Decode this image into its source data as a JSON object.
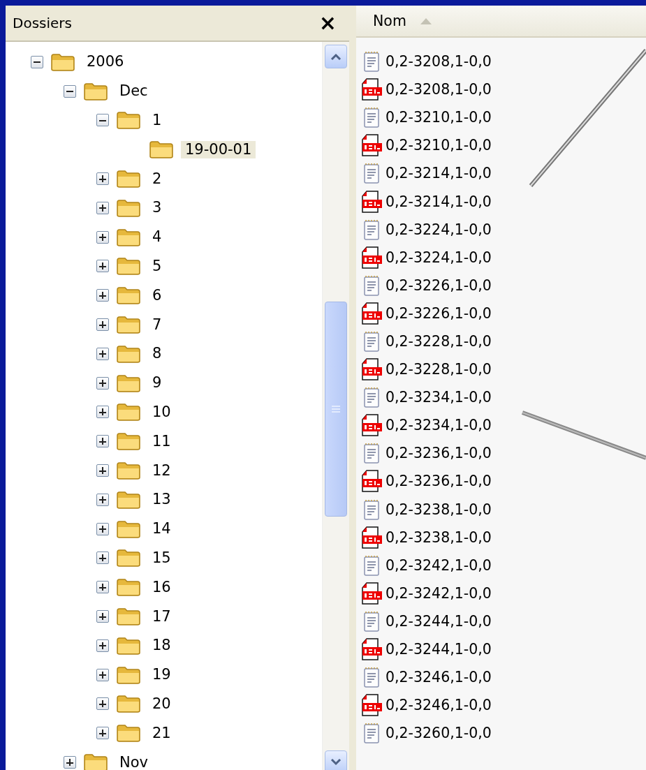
{
  "folders_pane": {
    "title": "Dossiers",
    "close": "×",
    "tree": [
      {
        "label": "2006",
        "expanded": true,
        "selected": false,
        "children": [
          {
            "label": "Dec",
            "expanded": true,
            "selected": false,
            "children": [
              {
                "label": "1",
                "expanded": true,
                "selected": false,
                "children": [
                  {
                    "label": "19-00-01",
                    "selected": true
                  }
                ]
              },
              {
                "label": "2",
                "expanded": false,
                "selected": false
              },
              {
                "label": "3",
                "expanded": false,
                "selected": false
              },
              {
                "label": "4",
                "expanded": false,
                "selected": false
              },
              {
                "label": "5",
                "expanded": false,
                "selected": false
              },
              {
                "label": "6",
                "expanded": false,
                "selected": false
              },
              {
                "label": "7",
                "expanded": false,
                "selected": false
              },
              {
                "label": "8",
                "expanded": false,
                "selected": false
              },
              {
                "label": "9",
                "expanded": false,
                "selected": false
              },
              {
                "label": "10",
                "expanded": false,
                "selected": false
              },
              {
                "label": "11",
                "expanded": false,
                "selected": false
              },
              {
                "label": "12",
                "expanded": false,
                "selected": false
              },
              {
                "label": "13",
                "expanded": false,
                "selected": false
              },
              {
                "label": "14",
                "expanded": false,
                "selected": false
              },
              {
                "label": "15",
                "expanded": false,
                "selected": false
              },
              {
                "label": "16",
                "expanded": false,
                "selected": false
              },
              {
                "label": "17",
                "expanded": false,
                "selected": false
              },
              {
                "label": "18",
                "expanded": false,
                "selected": false
              },
              {
                "label": "19",
                "expanded": false,
                "selected": false
              },
              {
                "label": "20",
                "expanded": false,
                "selected": false
              },
              {
                "label": "21",
                "expanded": false,
                "selected": false
              }
            ]
          },
          {
            "label": "Nov",
            "expanded": false,
            "selected": false
          }
        ]
      }
    ]
  },
  "file_list": {
    "columns": [
      "Nom"
    ],
    "files": [
      {
        "name": "0,2-3208,1-0,0",
        "kind": "text"
      },
      {
        "name": "0,2-3208,1-0,0",
        "kind": "xml"
      },
      {
        "name": "0,2-3210,1-0,0",
        "kind": "text"
      },
      {
        "name": "0,2-3210,1-0,0",
        "kind": "xml"
      },
      {
        "name": "0,2-3214,1-0,0",
        "kind": "text"
      },
      {
        "name": "0,2-3214,1-0,0",
        "kind": "xml"
      },
      {
        "name": "0,2-3224,1-0,0",
        "kind": "text"
      },
      {
        "name": "0,2-3224,1-0,0",
        "kind": "xml"
      },
      {
        "name": "0,2-3226,1-0,0",
        "kind": "text"
      },
      {
        "name": "0,2-3226,1-0,0",
        "kind": "xml"
      },
      {
        "name": "0,2-3228,1-0,0",
        "kind": "text"
      },
      {
        "name": "0,2-3228,1-0,0",
        "kind": "xml"
      },
      {
        "name": "0,2-3234,1-0,0",
        "kind": "text"
      },
      {
        "name": "0,2-3234,1-0,0",
        "kind": "xml"
      },
      {
        "name": "0,2-3236,1-0,0",
        "kind": "text"
      },
      {
        "name": "0,2-3236,1-0,0",
        "kind": "xml"
      },
      {
        "name": "0,2-3238,1-0,0",
        "kind": "text"
      },
      {
        "name": "0,2-3238,1-0,0",
        "kind": "xml"
      },
      {
        "name": "0,2-3242,1-0,0",
        "kind": "text"
      },
      {
        "name": "0,2-3242,1-0,0",
        "kind": "xml"
      },
      {
        "name": "0,2-3244,1-0,0",
        "kind": "text"
      },
      {
        "name": "0,2-3244,1-0,0",
        "kind": "xml"
      },
      {
        "name": "0,2-3246,1-0,0",
        "kind": "text"
      },
      {
        "name": "0,2-3246,1-0,0",
        "kind": "xml"
      },
      {
        "name": "0,2-3260,1-0,0",
        "kind": "text"
      }
    ]
  }
}
